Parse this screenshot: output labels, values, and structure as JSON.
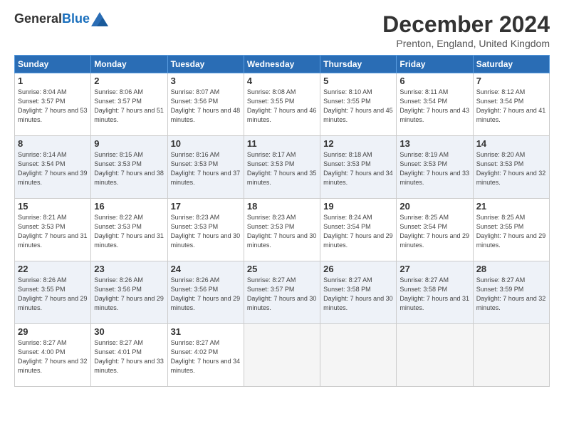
{
  "logo": {
    "general": "General",
    "blue": "Blue"
  },
  "title": "December 2024",
  "subtitle": "Prenton, England, United Kingdom",
  "days_of_week": [
    "Sunday",
    "Monday",
    "Tuesday",
    "Wednesday",
    "Thursday",
    "Friday",
    "Saturday"
  ],
  "weeks": [
    [
      {
        "day": "1",
        "sunrise": "8:04 AM",
        "sunset": "3:57 PM",
        "daylight": "7 hours and 53 minutes."
      },
      {
        "day": "2",
        "sunrise": "8:06 AM",
        "sunset": "3:57 PM",
        "daylight": "7 hours and 51 minutes."
      },
      {
        "day": "3",
        "sunrise": "8:07 AM",
        "sunset": "3:56 PM",
        "daylight": "7 hours and 48 minutes."
      },
      {
        "day": "4",
        "sunrise": "8:08 AM",
        "sunset": "3:55 PM",
        "daylight": "7 hours and 46 minutes."
      },
      {
        "day": "5",
        "sunrise": "8:10 AM",
        "sunset": "3:55 PM",
        "daylight": "7 hours and 45 minutes."
      },
      {
        "day": "6",
        "sunrise": "8:11 AM",
        "sunset": "3:54 PM",
        "daylight": "7 hours and 43 minutes."
      },
      {
        "day": "7",
        "sunrise": "8:12 AM",
        "sunset": "3:54 PM",
        "daylight": "7 hours and 41 minutes."
      }
    ],
    [
      {
        "day": "8",
        "sunrise": "8:14 AM",
        "sunset": "3:54 PM",
        "daylight": "7 hours and 39 minutes."
      },
      {
        "day": "9",
        "sunrise": "8:15 AM",
        "sunset": "3:53 PM",
        "daylight": "7 hours and 38 minutes."
      },
      {
        "day": "10",
        "sunrise": "8:16 AM",
        "sunset": "3:53 PM",
        "daylight": "7 hours and 37 minutes."
      },
      {
        "day": "11",
        "sunrise": "8:17 AM",
        "sunset": "3:53 PM",
        "daylight": "7 hours and 35 minutes."
      },
      {
        "day": "12",
        "sunrise": "8:18 AM",
        "sunset": "3:53 PM",
        "daylight": "7 hours and 34 minutes."
      },
      {
        "day": "13",
        "sunrise": "8:19 AM",
        "sunset": "3:53 PM",
        "daylight": "7 hours and 33 minutes."
      },
      {
        "day": "14",
        "sunrise": "8:20 AM",
        "sunset": "3:53 PM",
        "daylight": "7 hours and 32 minutes."
      }
    ],
    [
      {
        "day": "15",
        "sunrise": "8:21 AM",
        "sunset": "3:53 PM",
        "daylight": "7 hours and 31 minutes."
      },
      {
        "day": "16",
        "sunrise": "8:22 AM",
        "sunset": "3:53 PM",
        "daylight": "7 hours and 31 minutes."
      },
      {
        "day": "17",
        "sunrise": "8:23 AM",
        "sunset": "3:53 PM",
        "daylight": "7 hours and 30 minutes."
      },
      {
        "day": "18",
        "sunrise": "8:23 AM",
        "sunset": "3:53 PM",
        "daylight": "7 hours and 30 minutes."
      },
      {
        "day": "19",
        "sunrise": "8:24 AM",
        "sunset": "3:54 PM",
        "daylight": "7 hours and 29 minutes."
      },
      {
        "day": "20",
        "sunrise": "8:25 AM",
        "sunset": "3:54 PM",
        "daylight": "7 hours and 29 minutes."
      },
      {
        "day": "21",
        "sunrise": "8:25 AM",
        "sunset": "3:55 PM",
        "daylight": "7 hours and 29 minutes."
      }
    ],
    [
      {
        "day": "22",
        "sunrise": "8:26 AM",
        "sunset": "3:55 PM",
        "daylight": "7 hours and 29 minutes."
      },
      {
        "day": "23",
        "sunrise": "8:26 AM",
        "sunset": "3:56 PM",
        "daylight": "7 hours and 29 minutes."
      },
      {
        "day": "24",
        "sunrise": "8:26 AM",
        "sunset": "3:56 PM",
        "daylight": "7 hours and 29 minutes."
      },
      {
        "day": "25",
        "sunrise": "8:27 AM",
        "sunset": "3:57 PM",
        "daylight": "7 hours and 30 minutes."
      },
      {
        "day": "26",
        "sunrise": "8:27 AM",
        "sunset": "3:58 PM",
        "daylight": "7 hours and 30 minutes."
      },
      {
        "day": "27",
        "sunrise": "8:27 AM",
        "sunset": "3:58 PM",
        "daylight": "7 hours and 31 minutes."
      },
      {
        "day": "28",
        "sunrise": "8:27 AM",
        "sunset": "3:59 PM",
        "daylight": "7 hours and 32 minutes."
      }
    ],
    [
      {
        "day": "29",
        "sunrise": "8:27 AM",
        "sunset": "4:00 PM",
        "daylight": "7 hours and 32 minutes."
      },
      {
        "day": "30",
        "sunrise": "8:27 AM",
        "sunset": "4:01 PM",
        "daylight": "7 hours and 33 minutes."
      },
      {
        "day": "31",
        "sunrise": "8:27 AM",
        "sunset": "4:02 PM",
        "daylight": "7 hours and 34 minutes."
      },
      null,
      null,
      null,
      null
    ]
  ]
}
